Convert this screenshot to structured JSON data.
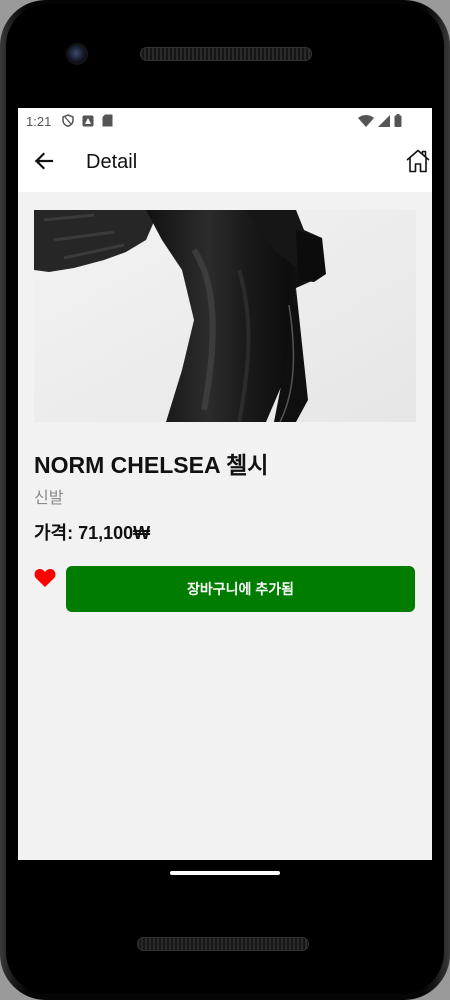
{
  "status_bar": {
    "time": "1:21"
  },
  "app_bar": {
    "title": "Detail"
  },
  "icons": {
    "back": "arrow-left-icon",
    "home": "home-icon",
    "favorite": "heart-icon"
  },
  "product": {
    "name": "NORM CHELSEA 첼시",
    "category": "신발",
    "price": "가격: 71,100₩",
    "is_favorite": true,
    "cart_button_label": "장바구니에 추가됨"
  },
  "colors": {
    "accent_green": "#007d00",
    "heart_red": "#ff0000",
    "background": "#f2f2f2"
  }
}
